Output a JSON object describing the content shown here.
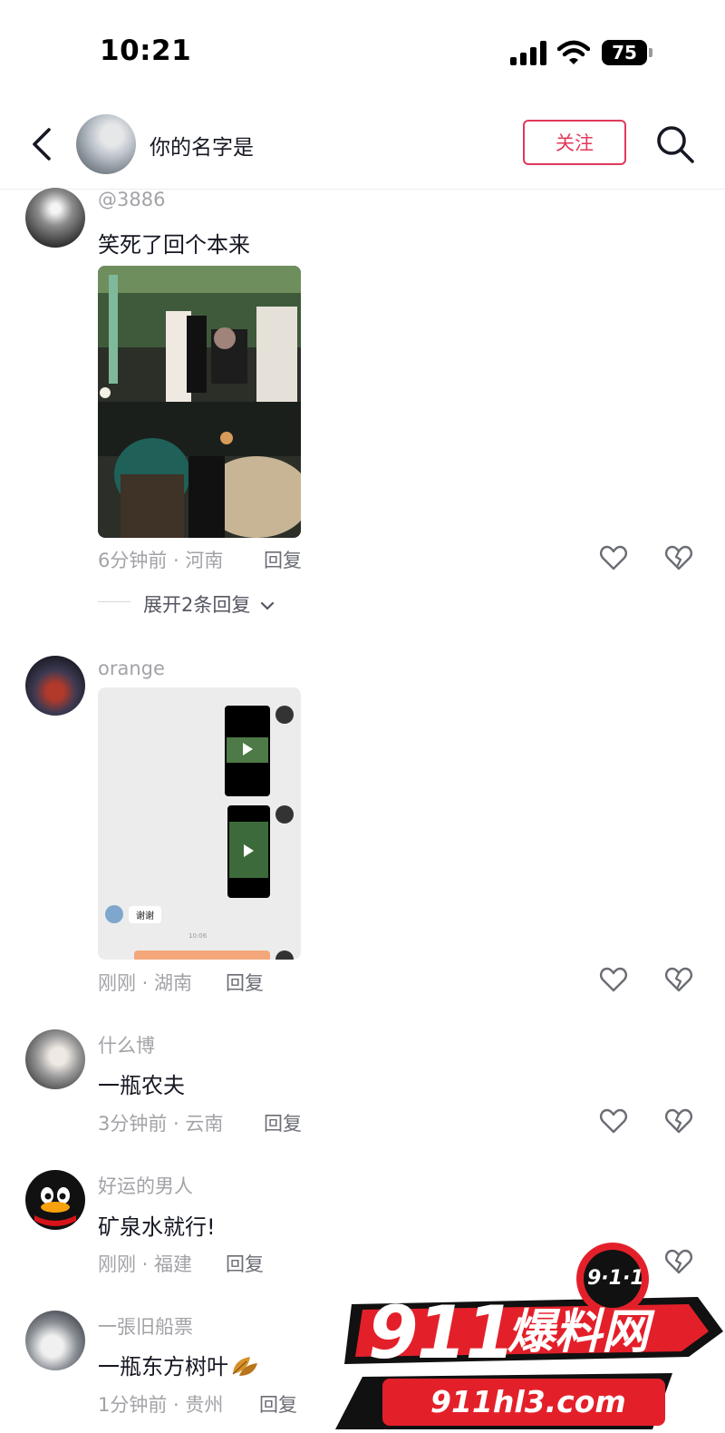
{
  "status_bar": {
    "time": "10:21",
    "battery": "75"
  },
  "header": {
    "title": "你的名字是",
    "follow_label": "关注"
  },
  "comments": [
    {
      "user": "@3886",
      "text": "笑死了回个本来",
      "meta": "6分钟前 · 河南",
      "reply_label": "回复",
      "expand_label": "展开2条回复"
    },
    {
      "user": "orange",
      "text": "",
      "meta": "刚刚 · 湖南",
      "reply_label": "回复",
      "chat_reply": "谢谢",
      "chat_time": "10:06"
    },
    {
      "user": "什么博",
      "text": "一瓶农夫",
      "meta": "3分钟前 · 云南",
      "reply_label": "回复"
    },
    {
      "user": "好运的男人",
      "text": "矿泉水就行!",
      "meta": "刚刚 · 福建",
      "reply_label": "回复"
    },
    {
      "user": "一張旧船票",
      "text": "一瓶东方树叶",
      "meta": "1分钟前 · 贵州",
      "reply_label": "回复"
    }
  ],
  "watermark": {
    "big": "911",
    "name": "爆料网",
    "badge": "9·1·1",
    "site": "911hl3.com"
  },
  "colors": {
    "accent": "#e0395a",
    "meta_gray": "#a2a3a7",
    "text": "#161823",
    "watermark_red": "#e3202a"
  },
  "icons": [
    "back-arrow-icon",
    "search-icon",
    "heart-icon",
    "broken-heart-icon",
    "play-icon",
    "leaf-emoji"
  ]
}
